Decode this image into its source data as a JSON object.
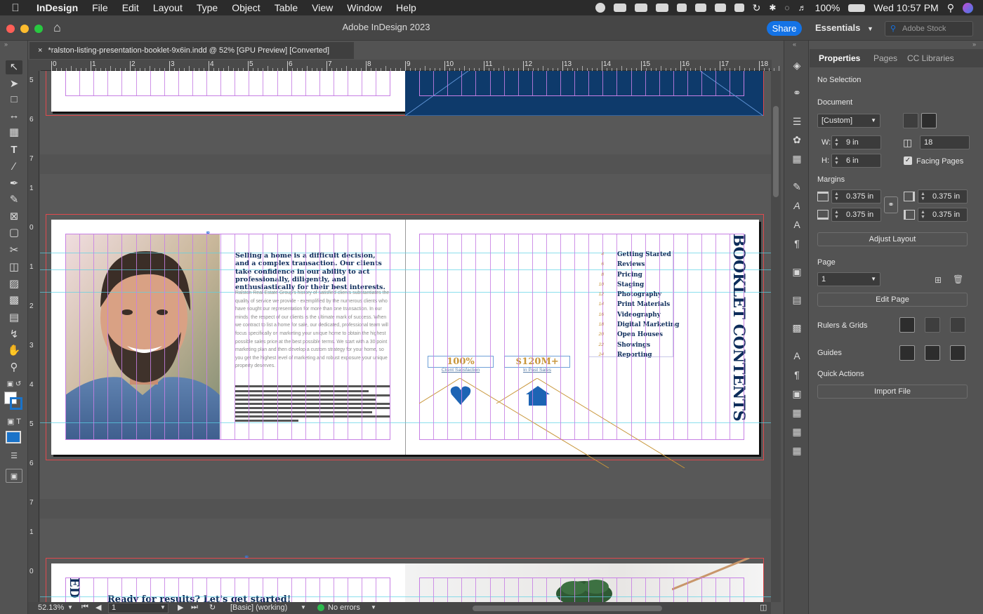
{
  "menubar": {
    "app_name": "InDesign",
    "items": [
      "File",
      "Edit",
      "Layout",
      "Type",
      "Object",
      "Table",
      "View",
      "Window",
      "Help"
    ],
    "battery": "100%",
    "clock": "Wed 10:57 PM"
  },
  "titlebar": {
    "title": "Adobe InDesign 2023",
    "share_label": "Share",
    "workspace_label": "Essentials",
    "stock_placeholder": "Adobe Stock"
  },
  "document_tab": {
    "title": "*ralston-listing-presentation-booklet-9x6in.indd @ 52% [GPU Preview] [Converted]"
  },
  "ruler": {
    "h_ticks": [
      "0",
      "1",
      "2",
      "3",
      "4",
      "5",
      "6",
      "7",
      "8",
      "9",
      "10",
      "11",
      "12",
      "13",
      "14",
      "15",
      "16",
      "17",
      "18"
    ],
    "v_ticks_top": [
      "5",
      "6",
      "7"
    ],
    "v_ticks_mid": [
      "1",
      "0",
      "1",
      "2",
      "3",
      "4",
      "5",
      "6",
      "7"
    ],
    "v_ticks_bottom": [
      "1",
      "0"
    ]
  },
  "spread": {
    "headline": "Selling a home is a difficult decision, and a complex transaction. Our clients take confidence in our ability to act professionally, diligently, and enthusiastically for their best interests.",
    "body": "Ralston Real Estate Group's history of satisfied clients substantiates the quality of service we provide - exemplified by the numerous clients who have sought our representation for more than one transaction. In our minds, the respect of our clients is the ultimate mark of success. When we contract to list a home for sale, our dedicated, professional team will focus specifically on marketing your unique home to obtain the highest possible sales price at the best possible terms. We start with a 30 point marketing plan and then develop a custom strategy for your home, so you get the highest level of marketing and robust exposure your unique property deserves.",
    "stats": [
      {
        "value": "100%",
        "label": "Client Satisfaction"
      },
      {
        "value": "$120M+",
        "label": "In Past Sales"
      }
    ],
    "contents_title": "BOOKLET CONTENTS",
    "contents": [
      {
        "page": "4",
        "title": "Getting Started"
      },
      {
        "page": "6",
        "title": "Reviews"
      },
      {
        "page": "8",
        "title": "Pricing"
      },
      {
        "page": "10",
        "title": "Staging"
      },
      {
        "page": "12",
        "title": "Photography"
      },
      {
        "page": "14",
        "title": "Print Materials"
      },
      {
        "page": "16",
        "title": "Videography"
      },
      {
        "page": "18",
        "title": "Digital Marketing"
      },
      {
        "page": "20",
        "title": "Open Houses"
      },
      {
        "page": "22",
        "title": "Showings"
      },
      {
        "page": "24",
        "title": "Reporting"
      }
    ],
    "next_spread_headline": "Ready for results? Let's get started!",
    "next_spread_vertical": "ED"
  },
  "status": {
    "zoom": "52.13%",
    "page": "1",
    "preflight_profile": "[Basic] (working)",
    "errors": "No errors"
  },
  "properties": {
    "tabs": [
      "Properties",
      "Pages",
      "CC Libraries"
    ],
    "selection": "No Selection",
    "document_label": "Document",
    "preset": "[Custom]",
    "w_label": "W:",
    "w_value": "9 in",
    "h_label": "H:",
    "h_value": "6 in",
    "pages_count": "18",
    "facing_pages": "Facing Pages",
    "margins_label": "Margins",
    "margin_top": "0.375 in",
    "margin_bottom": "0.375 in",
    "margin_left": "0.375 in",
    "margin_right": "0.375 in",
    "adjust_layout": "Adjust Layout",
    "page_label": "Page",
    "page_value": "1",
    "edit_page": "Edit Page",
    "rulers_grids": "Rulers & Grids",
    "guides": "Guides",
    "quick_actions": "Quick Actions",
    "import_file": "Import File"
  },
  "colors": {
    "accent": "#1473e6",
    "navy": "#0d2c5a",
    "gold": "#c8963a",
    "grid": "#c77fe4"
  }
}
